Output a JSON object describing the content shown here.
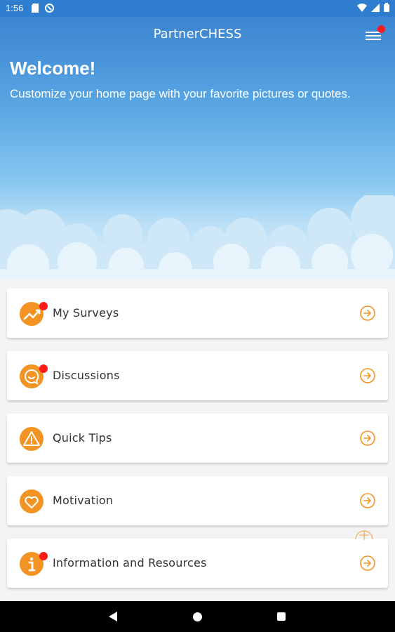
{
  "status_bar": {
    "time": "1:56"
  },
  "header": {
    "app_title": "PartnerCHESS"
  },
  "hero": {
    "welcome": "Welcome!",
    "subtitle": "Customize your home page with your favorite pictures or quotes."
  },
  "menu": {
    "items": [
      {
        "label": "My Surveys",
        "icon": "chart-icon",
        "notification": true
      },
      {
        "label": "Discussions",
        "icon": "chat-icon",
        "notification": true
      },
      {
        "label": "Quick Tips",
        "icon": "warning-icon",
        "notification": false
      },
      {
        "label": "Motivation",
        "icon": "heart-icon",
        "notification": false
      },
      {
        "label": "Information and Resources",
        "icon": "info-icon",
        "notification": true
      }
    ]
  },
  "colors": {
    "accent": "#f39323",
    "badge": "#ff1a1a",
    "status_bar": "#2e7dcf"
  }
}
